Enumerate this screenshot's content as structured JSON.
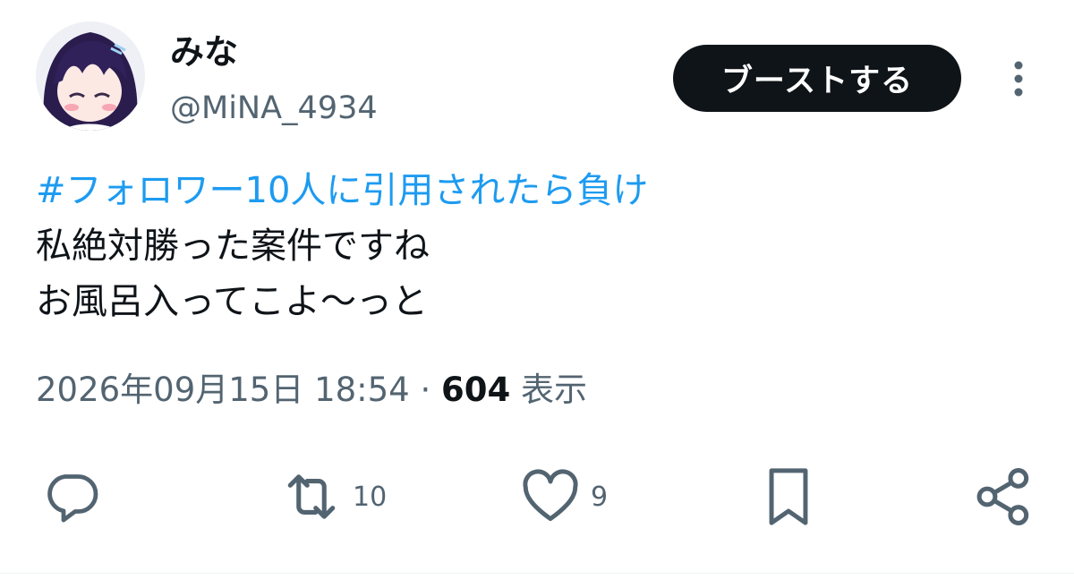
{
  "author": {
    "display_name": "みな",
    "handle": "@MiNA_4934",
    "avatar_icon": "user-avatar"
  },
  "header": {
    "boost_label": "ブーストする",
    "more_icon": "more-vertical-icon"
  },
  "tweet": {
    "hashtag": "#フォロワー10人に引用されたら負け",
    "line2": "私絶対勝った案件ですね",
    "line3": "お風呂入ってこよ〜っと"
  },
  "meta": {
    "timestamp": "2026年09月15日 18:54",
    "separator": "·",
    "views_count": "604",
    "views_label": "表示"
  },
  "actions": {
    "reply": {
      "icon": "reply-icon",
      "count": ""
    },
    "retweet": {
      "icon": "retweet-icon",
      "count": "10"
    },
    "like": {
      "icon": "heart-icon",
      "count": "9"
    },
    "bookmark": {
      "icon": "bookmark-icon",
      "count": ""
    },
    "share": {
      "icon": "share-icon",
      "count": ""
    }
  },
  "colors": {
    "text": "#0f1419",
    "secondary": "#536471",
    "link": "#1d9bf0",
    "button_bg": "#0f1419"
  }
}
